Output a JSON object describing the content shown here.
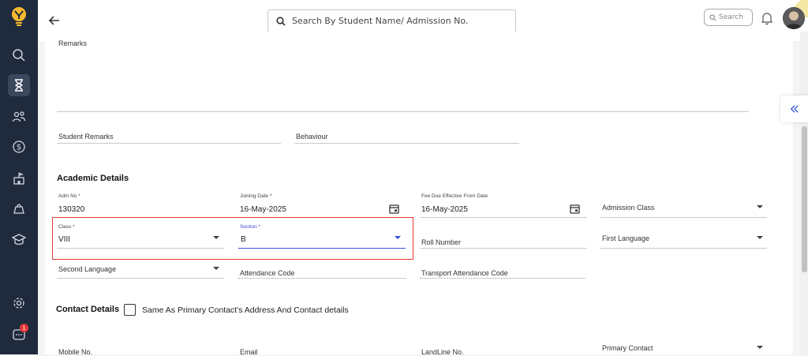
{
  "header": {
    "search_placeholder": "Search By Student Name/ Admission No.",
    "small_search_placeholder": "Search"
  },
  "remarks": {
    "label": "Remarks"
  },
  "student_remarks_label": "Student Remarks",
  "behaviour_label": "Behaviour",
  "academic": {
    "heading": "Academic Details",
    "adm_no_label": "Adm No *",
    "adm_no_value": "130320",
    "joining_date_label": "Joining Date *",
    "joining_date_value": "16-May-2025",
    "fee_due_label": "Fee Due Effective From Date",
    "fee_due_value": "16-May-2025",
    "admission_class_label": "Admission Class",
    "class_label": "Class *",
    "class_value": "VIII",
    "section_label": "Section *",
    "section_value": "B",
    "roll_number_label": "Roll Number",
    "first_language_label": "First Language",
    "second_language_label": "Second Language",
    "attendance_code_label": "Attendance Code",
    "transport_attendance_label": "Transport Attendance Code"
  },
  "contact": {
    "heading": "Contact Details",
    "same_as_label": "Same As Primary Contact's Address And Contact details",
    "mobile_label": "Mobile No.",
    "email_label": "Email",
    "landline_label": "LandLine No.",
    "primary_contact_label": "Primary Contact"
  },
  "notification_count": "1",
  "colors": {
    "sidebar": "#1f2a3d",
    "accent": "#3b4ed8",
    "highlight": "#e53935"
  }
}
